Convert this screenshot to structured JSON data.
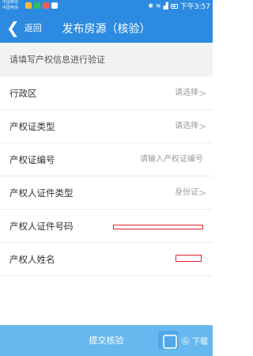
{
  "status_bar": {
    "carrier_1": "中国移动",
    "carrier_2": "中国电信",
    "time": "下午3:57",
    "app_icon_colors": [
      "#ffbe34",
      "#30c05a",
      "#ff5a5a",
      "#ffffff"
    ]
  },
  "nav": {
    "back_label": "返回",
    "title": "发布房源（核验）",
    "back_icon": "chevron-left-icon"
  },
  "hint": "请填写产权信息进行验证",
  "form": {
    "district": {
      "label": "行政区",
      "value": "请选择"
    },
    "cert_type": {
      "label": "产权证类型",
      "value": "请选择"
    },
    "cert_number": {
      "label": "产权证编号",
      "placeholder": "请输入产权证编号"
    },
    "id_type": {
      "label": "产权人证件类型",
      "value": "身份证"
    },
    "id_number": {
      "label": "产权人证件号码"
    },
    "owner_name": {
      "label": "产权人姓名"
    }
  },
  "submit_label": "提交核验",
  "watermark_text": "Ⓖ 下载",
  "colors": {
    "primary": "#2c8be0",
    "submit": "#66b8ee",
    "redaction": "#e0202e",
    "hint_bg": "#f1f2f4"
  }
}
